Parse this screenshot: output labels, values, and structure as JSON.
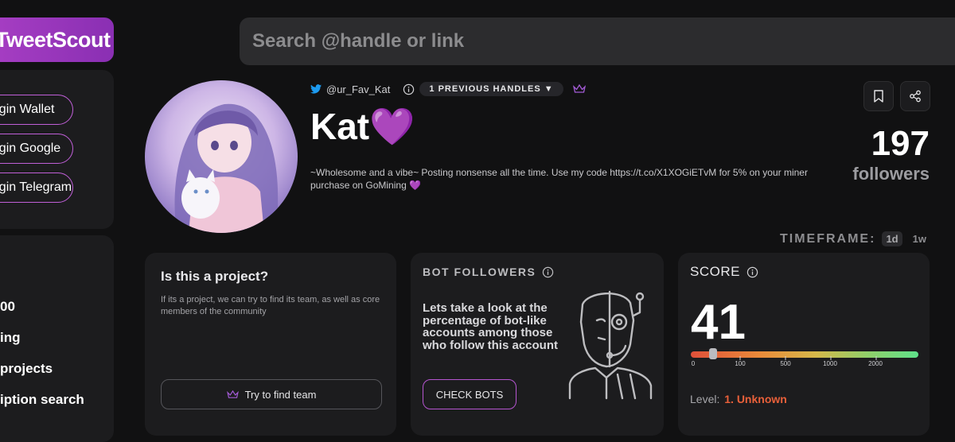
{
  "logo": {
    "text": "TweetScout"
  },
  "search": {
    "placeholder": "Search @handle or link"
  },
  "sidebar": {
    "login_buttons": [
      "Login Wallet",
      "Login Google",
      "Login Telegram"
    ],
    "nav_items": [
      "00",
      "ing",
      "projects",
      "iption search"
    ]
  },
  "profile": {
    "handle": "@ur_Fav_Kat",
    "previous_handles_label": "1 PREVIOUS HANDLES",
    "name": "Kat💜",
    "bio": "~Wholesome and a vibe~ Posting nonsense all the time. Use my code https://t.co/X1XOGiETvM for 5% on your miner purchase on GoMining 💜",
    "followers_count": "197",
    "followers_label": "followers"
  },
  "timeframe": {
    "label": "TIMEFRAME:",
    "options": [
      "1d",
      "1w"
    ],
    "selected": "1d"
  },
  "project_card": {
    "title": "Is this a project?",
    "description": "If its a project, we can try to find its team, as well as core members of the community",
    "button": "Try to find team"
  },
  "bot_card": {
    "title": "BOT FOLLOWERS",
    "description": "Lets take a look at the percentage of bot-like accounts among those who follow this account",
    "button": "CHECK BOTS"
  },
  "score_card": {
    "title": "SCORE",
    "value": "41",
    "scale_labels": [
      "0",
      "100",
      "500",
      "1000",
      "2000"
    ],
    "level_label": "Level:",
    "level_value": "1. Unknown"
  },
  "colors": {
    "accent": "#9b3fc2",
    "level": "#e8603a",
    "background": "#111112",
    "card": "#1c1c1e"
  }
}
